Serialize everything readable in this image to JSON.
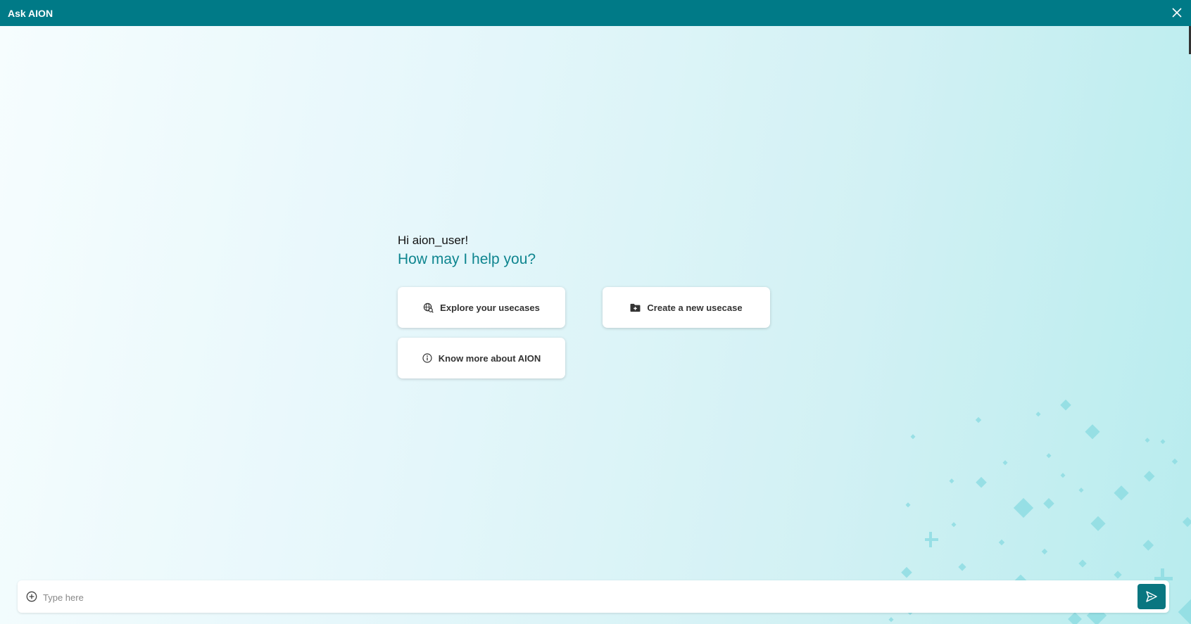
{
  "window": {
    "title": "Ask AION"
  },
  "welcome": {
    "greeting": "Hi aion_user!",
    "headline": "How may I help you?"
  },
  "actions": [
    {
      "label": "Explore your usecases",
      "icon": "globe-search-icon"
    },
    {
      "label": "Create a new usecase",
      "icon": "folder-plus-icon"
    },
    {
      "label": "Know more about AION",
      "icon": "info-icon"
    }
  ],
  "composer": {
    "placeholder": "Type here",
    "value": "",
    "attach_icon": "plus-circle-icon",
    "send_icon": "send-icon"
  },
  "colors": {
    "header": "#007a87",
    "accent_text": "#0e858f",
    "send_button": "#0a7680",
    "decoration": "#8fdde3"
  }
}
